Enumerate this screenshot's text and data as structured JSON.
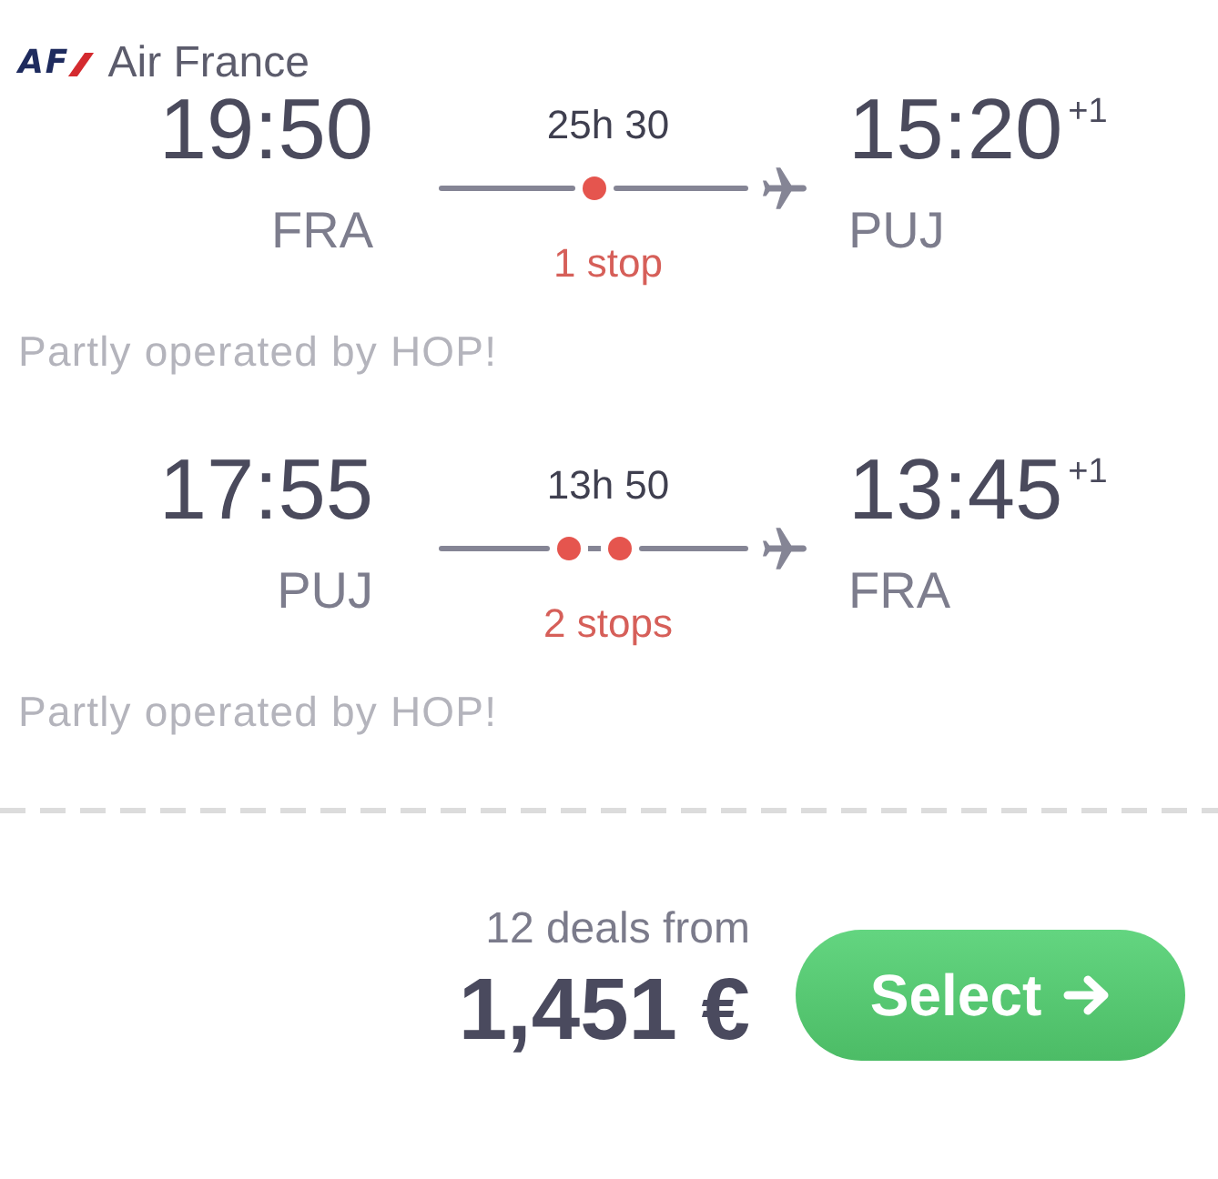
{
  "airline": {
    "logo": "AF",
    "name": "Air France"
  },
  "legs": [
    {
      "departure": {
        "time": "19:50",
        "airport": "FRA"
      },
      "duration": "25h 30",
      "route": [
        {
          "kind": "line"
        },
        {
          "kind": "stop"
        },
        {
          "kind": "line"
        }
      ],
      "stops": "1 stop",
      "arrival": {
        "time": "15:20",
        "day_offset": "+1",
        "airport": "PUJ"
      },
      "note": "Partly operated by HOP!"
    },
    {
      "departure": {
        "time": "17:55",
        "airport": "PUJ"
      },
      "duration": "13h 50",
      "route": [
        {
          "kind": "line"
        },
        {
          "kind": "stop"
        },
        {
          "kind": "dash"
        },
        {
          "kind": "stop"
        },
        {
          "kind": "line"
        }
      ],
      "stops": "2 stops",
      "arrival": {
        "time": "13:45",
        "day_offset": "+1",
        "airport": "FRA"
      },
      "note": "Partly operated by HOP!"
    }
  ],
  "offer": {
    "deals": "12 deals from",
    "price": "1,451 €",
    "button": "Select"
  }
}
